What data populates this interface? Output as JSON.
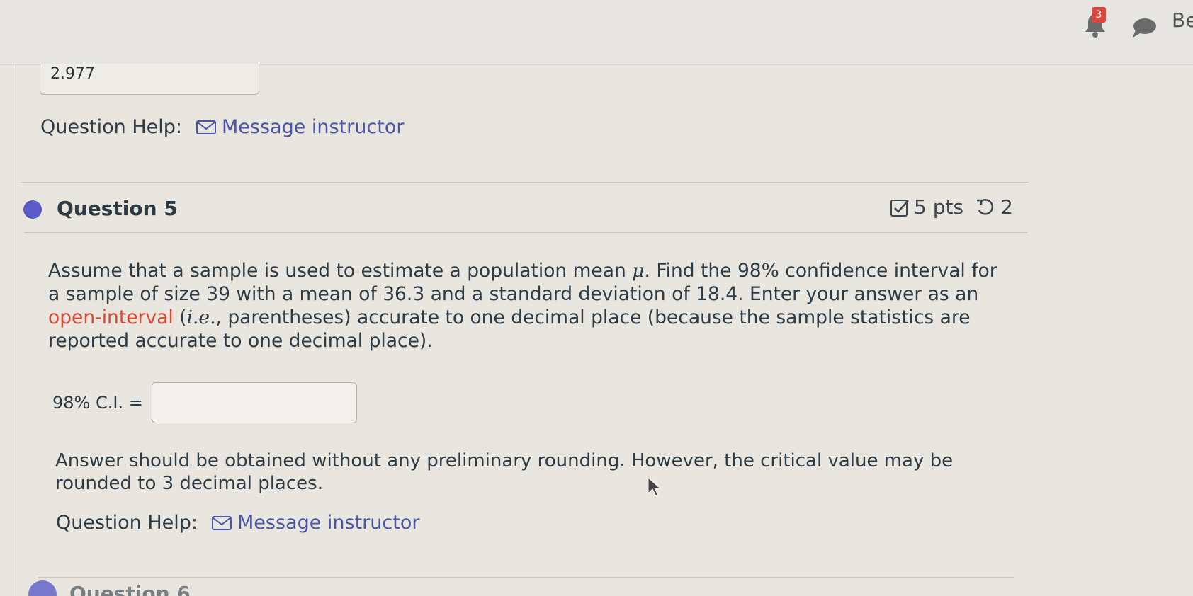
{
  "header": {
    "notification_count": "3",
    "user_name_partial": "Be"
  },
  "previous_question": {
    "answer_value": "2.977",
    "help_label": "Question Help:",
    "message_link": "Message instructor"
  },
  "question": {
    "title": "Question 5",
    "points": "5 pts",
    "retries": "2",
    "body_part1": "Assume that a sample is used to estimate a population mean ",
    "mu_symbol": "μ",
    "body_part2": ". Find the 98% confidence interval for a sample of size 39 with a mean of 36.3 and a standard deviation of 18.4. Enter your answer as an ",
    "open_interval_text": "open-interval",
    "body_part3": " (",
    "ie_text": "i.e.",
    "body_part4": ", parentheses) accurate to one decimal place (because the sample statistics are reported accurate to one decimal place).",
    "input_label": "98% C.I. =",
    "input_value": "",
    "note": "Answer should be obtained without any preliminary rounding. However, the critical value may be rounded to 3 decimal places.",
    "help_label": "Question Help:",
    "message_link": "Message instructor"
  },
  "next_question": {
    "title_partial": "Question 6"
  },
  "colors": {
    "link": "#4a55a8",
    "accent_dot": "#5a5bc6",
    "highlight_red": "#d6492f",
    "badge_red": "#d9473d"
  }
}
